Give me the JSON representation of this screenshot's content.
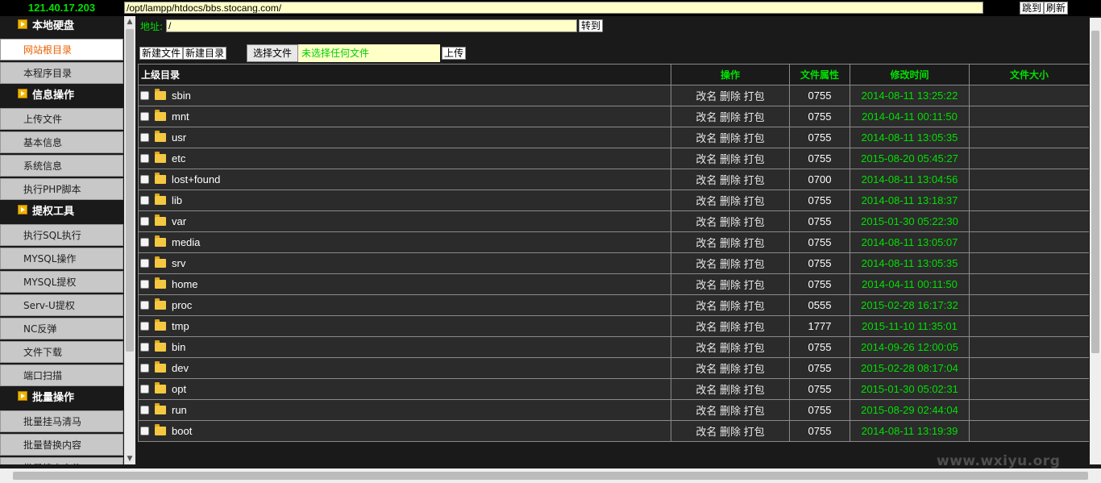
{
  "top": {
    "ip": "121.40.17.203",
    "path": "/opt/lampp/htdocs/bbs.stocang.com/",
    "jump_label": "跳到",
    "refresh_label": "刷新"
  },
  "sidebar": {
    "groups": [
      {
        "title": "本地硬盘",
        "items": [
          "网站根目录",
          "本程序目录"
        ]
      },
      {
        "title": "信息操作",
        "items": [
          "上传文件",
          "基本信息",
          "系统信息",
          "执行PHP脚本"
        ]
      },
      {
        "title": "提权工具",
        "items": [
          "执行SQL执行",
          "MYSQL操作",
          "MYSQL提权",
          "Serv-U提权",
          "NC反弹",
          "文件下载",
          "端口扫描"
        ]
      },
      {
        "title": "批量操作",
        "items": [
          "批量挂马清马",
          "批量替换内容",
          "批量搜索文件"
        ]
      }
    ]
  },
  "main": {
    "address_label": "地址:",
    "address_value": "/",
    "goto_label": "转到",
    "new_file_label": "新建文件",
    "new_dir_label": "新建目录",
    "choose_file_label": "选择文件",
    "no_file_label": "未选择任何文件",
    "upload_label": "上传"
  },
  "table": {
    "headers": {
      "parent": "上级目录",
      "ops": "操作",
      "perm": "文件属性",
      "mtime": "修改时间",
      "size": "文件大小"
    },
    "ops_text": "改名 删除 打包",
    "rows": [
      {
        "name": "sbin",
        "perm": "0755",
        "mtime": "2014-08-11 13:25:22"
      },
      {
        "name": "mnt",
        "perm": "0755",
        "mtime": "2014-04-11 00:11:50"
      },
      {
        "name": "usr",
        "perm": "0755",
        "mtime": "2014-08-11 13:05:35"
      },
      {
        "name": "etc",
        "perm": "0755",
        "mtime": "2015-08-20 05:45:27"
      },
      {
        "name": "lost+found",
        "perm": "0700",
        "mtime": "2014-08-11 13:04:56"
      },
      {
        "name": "lib",
        "perm": "0755",
        "mtime": "2014-08-11 13:18:37"
      },
      {
        "name": "var",
        "perm": "0755",
        "mtime": "2015-01-30 05:22:30"
      },
      {
        "name": "media",
        "perm": "0755",
        "mtime": "2014-08-11 13:05:07"
      },
      {
        "name": "srv",
        "perm": "0755",
        "mtime": "2014-08-11 13:05:35"
      },
      {
        "name": "home",
        "perm": "0755",
        "mtime": "2014-04-11 00:11:50"
      },
      {
        "name": "proc",
        "perm": "0555",
        "mtime": "2015-02-28 16:17:32"
      },
      {
        "name": "tmp",
        "perm": "1777",
        "mtime": "2015-11-10 11:35:01"
      },
      {
        "name": "bin",
        "perm": "0755",
        "mtime": "2014-09-26 12:00:05"
      },
      {
        "name": "dev",
        "perm": "0755",
        "mtime": "2015-02-28 08:17:04"
      },
      {
        "name": "opt",
        "perm": "0755",
        "mtime": "2015-01-30 05:02:31"
      },
      {
        "name": "run",
        "perm": "0755",
        "mtime": "2015-08-29 02:44:04"
      },
      {
        "name": "boot",
        "perm": "0755",
        "mtime": "2014-08-11 13:19:39"
      }
    ]
  },
  "watermark": "www.wxiyu.org",
  "colors": {
    "accent_green": "#00e000",
    "active_orange": "#e86000",
    "input_bg": "#ffffc8"
  }
}
